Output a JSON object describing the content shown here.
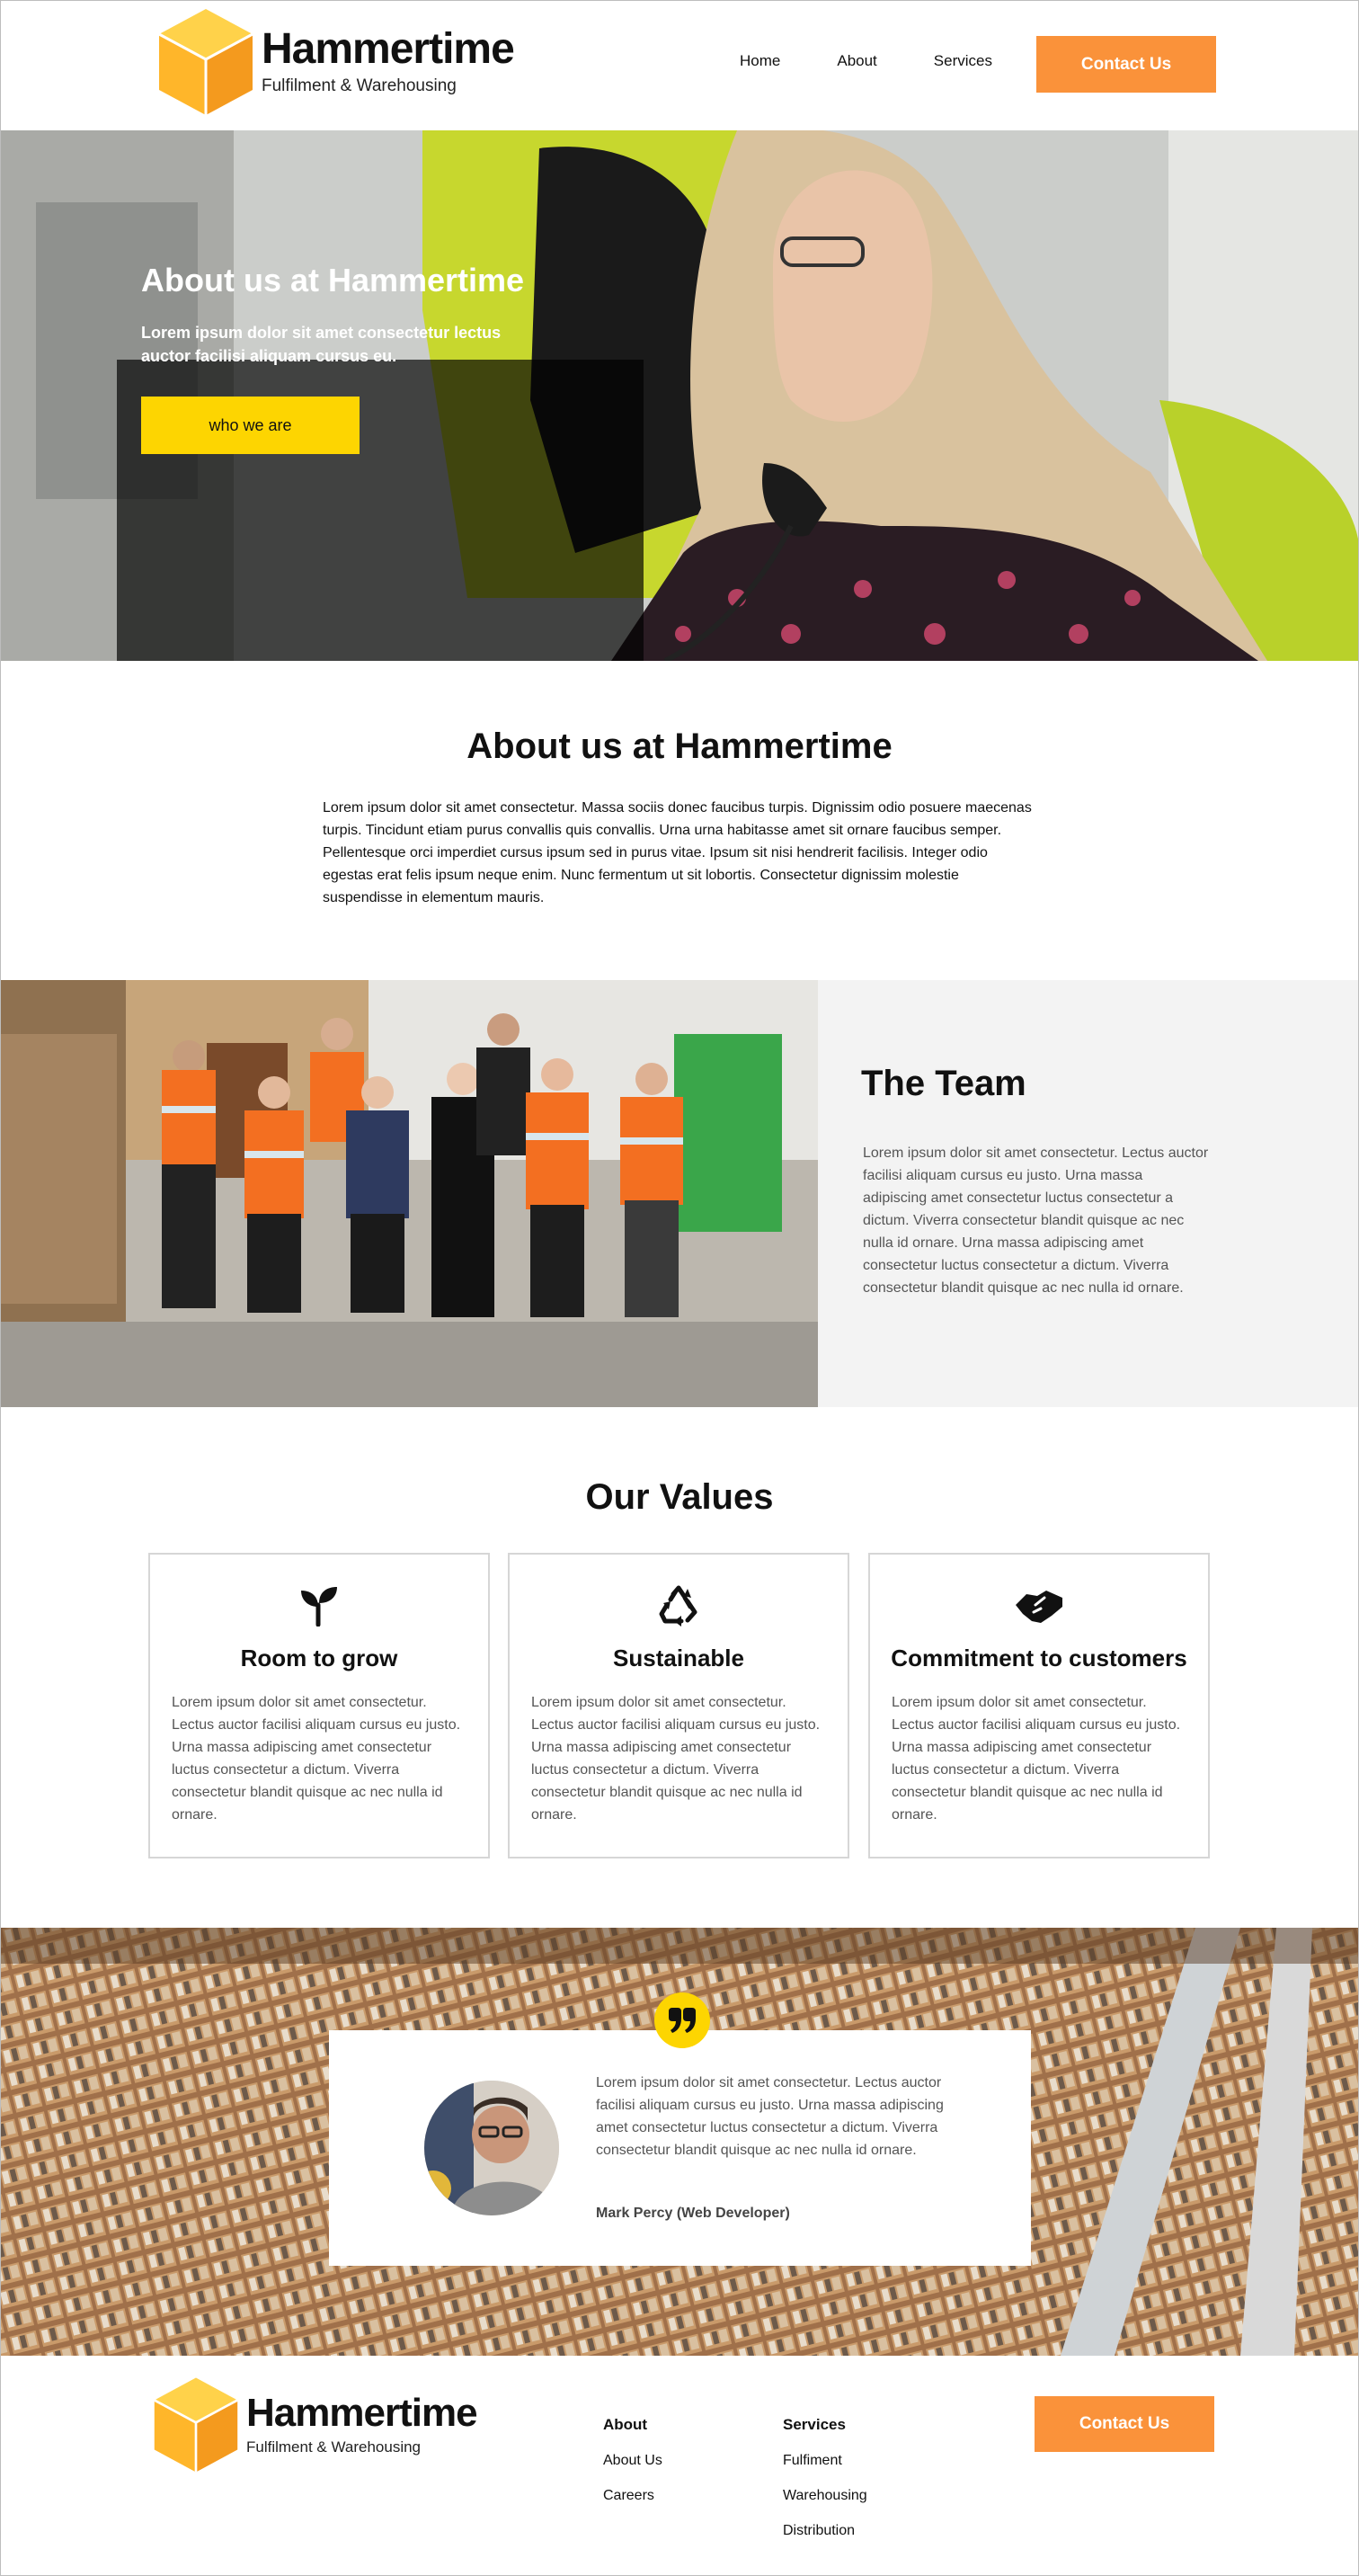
{
  "brand": {
    "name": "Hammertime",
    "tagline": "Fulfilment & Warehousing",
    "colors": {
      "orange": "#fa923a",
      "yellow": "#fdd501",
      "cube_light": "#ffc940",
      "cube_dark": "#f49a1e"
    }
  },
  "nav": {
    "items": [
      "Home",
      "About",
      "Services"
    ],
    "contact_label": "Contact Us"
  },
  "hero": {
    "title": "About us at Hammertime",
    "subtitle": "Lorem ipsum dolor sit amet consectetur lectus auctor facilisi aliquam cursus eu.",
    "button_label": "who we are"
  },
  "about": {
    "title": "About us at Hammertime",
    "text": "Lorem ipsum dolor sit amet consectetur. Massa sociis donec faucibus turpis. Dignissim odio posuere maecenas turpis. Tincidunt etiam purus convallis quis convallis. Urna urna habitasse amet sit ornare faucibus semper. Pellentesque orci imperdiet cursus ipsum sed in purus vitae. Ipsum sit nisi hendrerit facilisis. Integer odio egestas erat felis ipsum neque enim. Nunc fermentum ut sit lobortis. Consectetur dignissim molestie suspendisse in elementum mauris."
  },
  "team": {
    "title": "The Team",
    "text": "Lorem ipsum dolor sit amet consectetur. Lectus auctor facilisi aliquam cursus eu justo. Urna massa adipiscing amet consectetur luctus consectetur a dictum. Viverra consectetur blandit quisque ac nec nulla id ornare. Urna massa adipiscing amet consectetur luctus consectetur a dictum. Viverra consectetur blandit quisque ac nec nulla id ornare."
  },
  "values": {
    "title": "Our Values",
    "cards": [
      {
        "icon": "sprout-icon",
        "title": "Room to grow",
        "text": "Lorem ipsum dolor sit amet consectetur. Lectus auctor facilisi aliquam cursus eu justo. Urna massa adipiscing amet consectetur luctus consectetur a dictum. Viverra consectetur blandit quisque ac nec nulla id ornare."
      },
      {
        "icon": "recycle-icon",
        "title": "Sustainable",
        "text": "Lorem ipsum dolor sit amet consectetur. Lectus auctor facilisi aliquam cursus eu justo. Urna massa adipiscing amet consectetur luctus consectetur a dictum. Viverra consectetur blandit quisque ac nec nulla id ornare."
      },
      {
        "icon": "handshake-icon",
        "title": "Commitment to customers",
        "text": "Lorem ipsum dolor sit amet consectetur. Lectus auctor facilisi aliquam cursus eu justo. Urna massa adipiscing amet consectetur luctus consectetur a dictum. Viverra consectetur blandit quisque ac nec nulla id ornare."
      }
    ]
  },
  "testimonial": {
    "text": "Lorem ipsum dolor sit amet consectetur. Lectus auctor facilisi aliquam cursus eu justo. Urna massa adipiscing amet consectetur luctus consectetur a dictum. Viverra consectetur blandit quisque ac nec nulla id ornare.",
    "name": "Mark Percy (Web Developer)"
  },
  "footer": {
    "about_heading": "About",
    "about_links": [
      "About Us",
      "Careers"
    ],
    "services_heading": "Services",
    "services_links": [
      "Fulfiment",
      "Warehousing",
      "Distribution"
    ],
    "contact_label": "Contact Us"
  }
}
